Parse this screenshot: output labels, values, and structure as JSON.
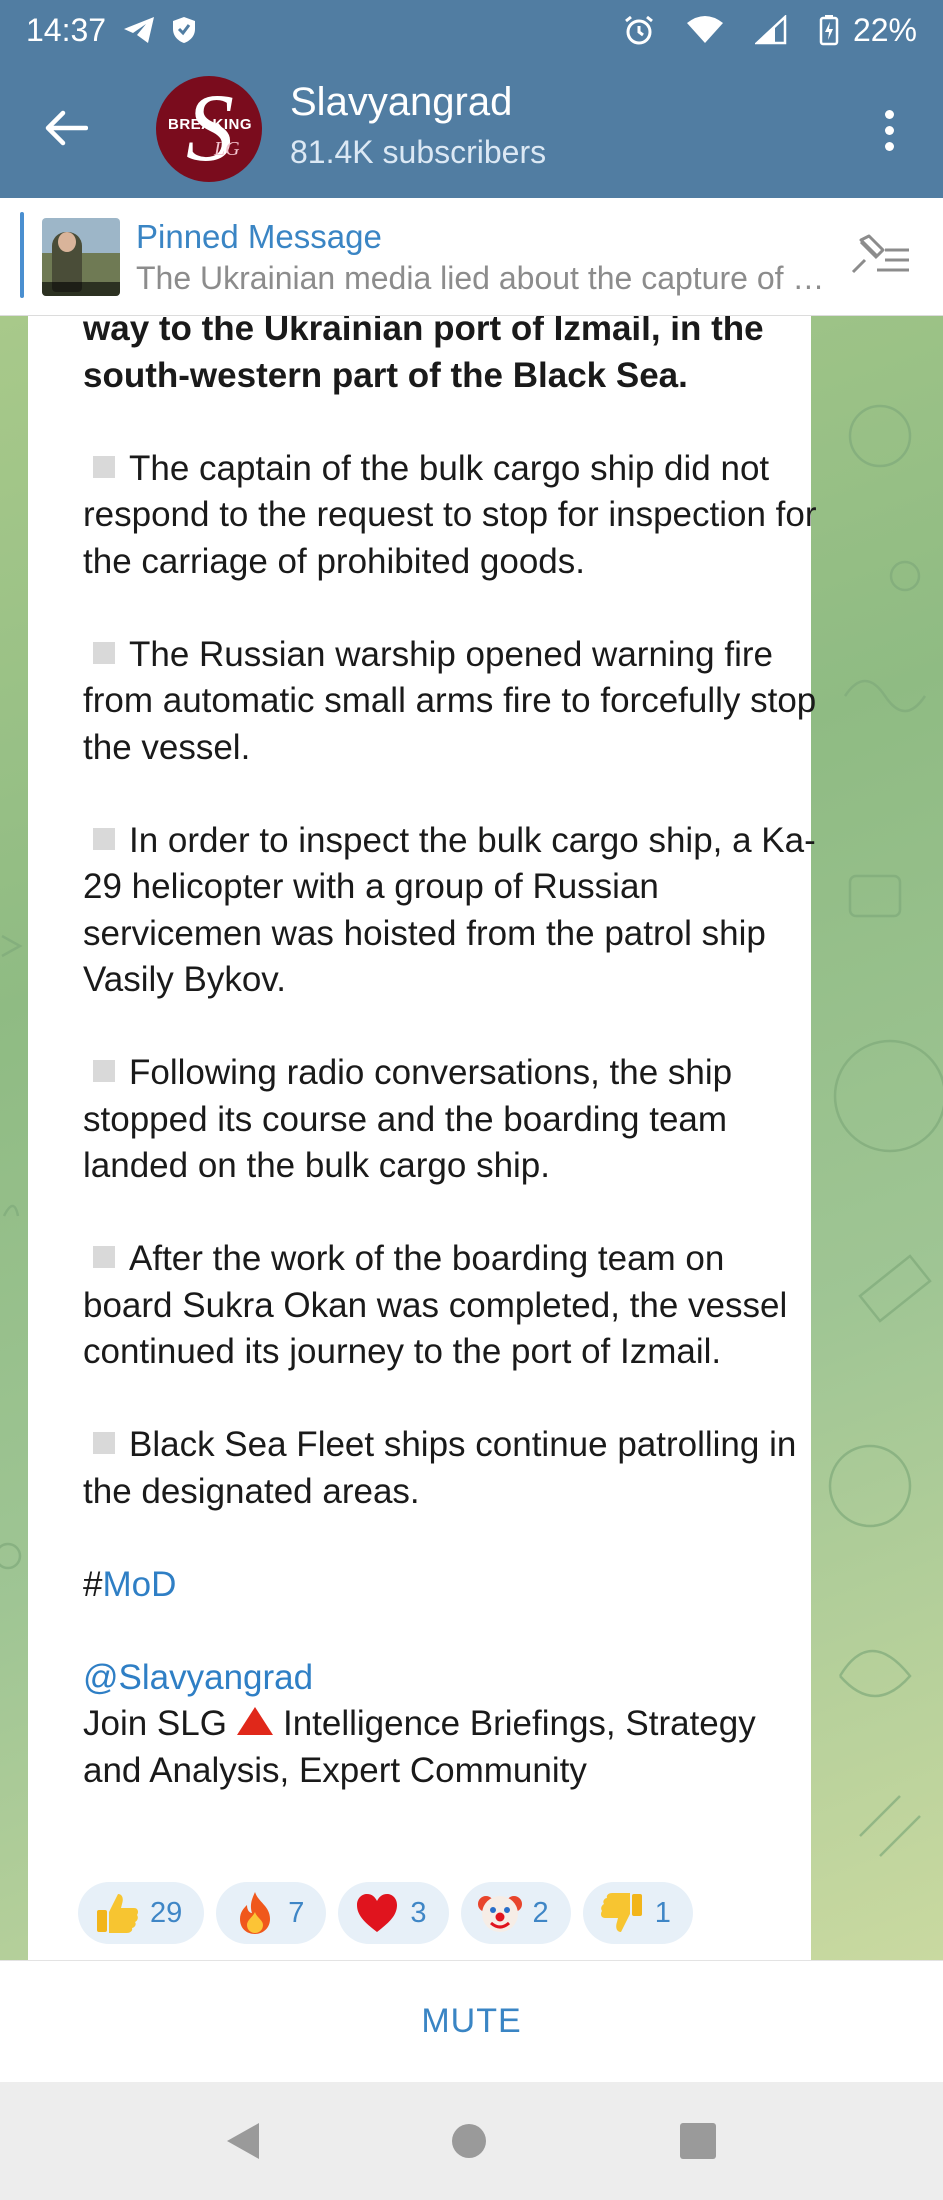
{
  "status_bar": {
    "time": "14:37",
    "battery": "22%",
    "icons": [
      "telegram-icon",
      "shield-icon",
      "alarm-icon",
      "wifi-icon",
      "signal-icon",
      "battery-charging-icon"
    ]
  },
  "header": {
    "title": "Slavyangrad",
    "subscribers": "81.4K subscribers",
    "avatar_text_top": "BREAKING",
    "avatar_letter": "S",
    "avatar_text_bottom": "LG"
  },
  "pinned": {
    "title": "Pinned Message",
    "text": "The Ukrainian media lied about the capture of the village of Rabotino"
  },
  "message": {
    "lead": "way to the Ukrainian port of Izmail, in the south-western part of the Black Sea.",
    "bullets": [
      "The captain of the bulk cargo ship did not respond to the request to stop for inspection for the carriage of prohibited goods.",
      "The Russian warship opened warning fire from automatic small arms fire to forcefully stop the vessel.",
      "In order to inspect the bulk cargo ship, a Ka-29 helicopter with a group of Russian servicemen was hoisted from the patrol ship Vasily Bykov.",
      "Following radio conversations, the ship stopped its course and the boarding team landed on the bulk cargo ship.",
      "After the work of the boarding team on board Sukra Okan was completed, the vessel continued its journey to the port of Izmail.",
      "Black Sea Fleet ships continue patrolling in the designated areas."
    ],
    "hashtag_prefix": "#",
    "hashtag": "MoD",
    "mention": "@Slavyangrad",
    "footer_before": "Join SLG",
    "footer_after": "Intelligence Briefings, Strategy and Analysis, Expert Community"
  },
  "reactions": [
    {
      "icon": "thumbs-up-icon",
      "count": "29"
    },
    {
      "icon": "fire-icon",
      "count": "7"
    },
    {
      "icon": "heart-icon",
      "count": "3"
    },
    {
      "icon": "clown-icon",
      "count": "2"
    },
    {
      "icon": "thumbs-down-icon",
      "count": "1"
    }
  ],
  "mute_label": "MUTE",
  "colors": {
    "header": "#517da2",
    "accent": "#3a85c4",
    "link": "#2f7fc5",
    "reaction_bg": "#e7f0f8"
  }
}
